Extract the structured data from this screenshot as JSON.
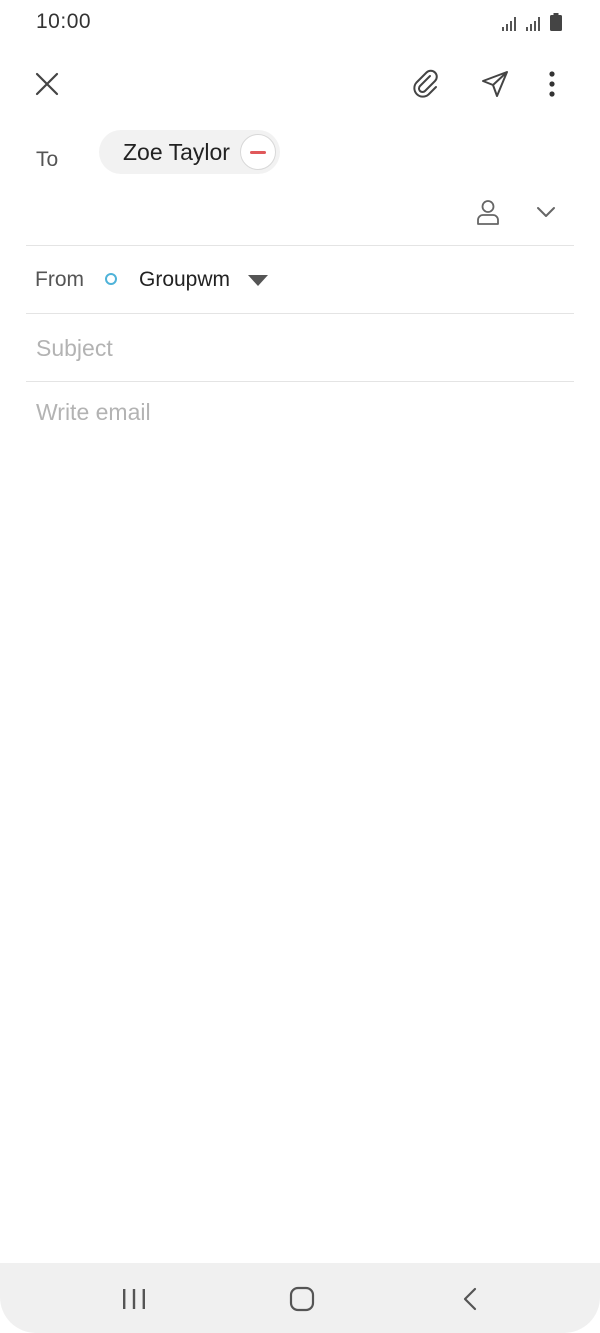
{
  "status_bar": {
    "time": "10:00",
    "icons": [
      "signal-icon",
      "signal-icon",
      "battery-icon"
    ]
  },
  "toolbar": {
    "close_icon": "close-icon",
    "attach_icon": "paperclip-icon",
    "send_icon": "send-icon",
    "more_icon": "more-vertical-icon"
  },
  "recipients": {
    "to_label": "To",
    "chips": [
      {
        "name": "Zoe Taylor",
        "remove_icon": "remove-icon"
      }
    ],
    "contact_icon": "person-icon",
    "expand_icon": "chevron-down-icon"
  },
  "from": {
    "label": "From",
    "account": "Groupwm",
    "account_color": "#4fb3d9",
    "dropdown_icon": "caret-down-icon"
  },
  "subject": {
    "placeholder": "Subject",
    "value": ""
  },
  "body": {
    "placeholder": "Write email",
    "value": ""
  },
  "nav_bar": {
    "recents_icon": "recents-icon",
    "home_icon": "home-icon",
    "back_icon": "back-icon"
  },
  "colors": {
    "remove_accent": "#e0585a",
    "placeholder": "#b3b3b3",
    "nav_background": "#f0f0f0"
  }
}
